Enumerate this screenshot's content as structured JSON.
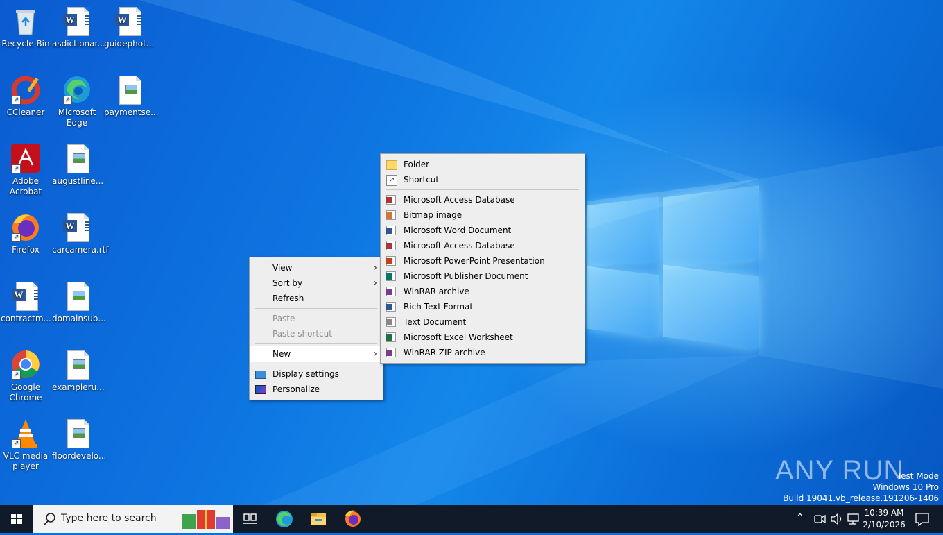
{
  "desktop_icons": [
    {
      "id": "recycle-bin",
      "label": "Recycle Bin",
      "icon": "recycle-bin-icon"
    },
    {
      "id": "asdictionar",
      "label": "asdictionar...",
      "icon": "word-document-icon"
    },
    {
      "id": "guidephot",
      "label": "guidephot...",
      "icon": "word-document-icon"
    },
    {
      "id": "ccleaner",
      "label": "CCleaner",
      "icon": "ccleaner-icon"
    },
    {
      "id": "edge",
      "label": "Microsoft Edge",
      "icon": "edge-icon"
    },
    {
      "id": "paymentse",
      "label": "paymentse...",
      "icon": "image-file-icon"
    },
    {
      "id": "acrobat",
      "label": "Adobe Acrobat",
      "icon": "adobe-acrobat-icon"
    },
    {
      "id": "augustline",
      "label": "augustline...",
      "icon": "image-file-icon"
    },
    {
      "id": "firefox",
      "label": "Firefox",
      "icon": "firefox-icon"
    },
    {
      "id": "carcamera",
      "label": "carcamera.rtf",
      "icon": "word-document-icon"
    },
    {
      "id": "contractm",
      "label": "contractm...",
      "icon": "word-document-icon"
    },
    {
      "id": "domainsub",
      "label": "domainsub...",
      "icon": "image-file-icon"
    },
    {
      "id": "chrome",
      "label": "Google Chrome",
      "icon": "chrome-icon"
    },
    {
      "id": "exampleru",
      "label": "exampleru...",
      "icon": "image-file-icon"
    },
    {
      "id": "vlc",
      "label": "VLC media player",
      "icon": "vlc-icon"
    },
    {
      "id": "floordevelo",
      "label": "floordevelo...",
      "icon": "image-file-icon"
    }
  ],
  "context_menu": {
    "view": "View",
    "sort_by": "Sort by",
    "refresh": "Refresh",
    "paste": "Paste",
    "paste_shortcut": "Paste shortcut",
    "new": "New",
    "display_settings": "Display settings",
    "personalize": "Personalize",
    "submenu_arrow": "›"
  },
  "new_submenu": {
    "folder": "Folder",
    "shortcut": "Shortcut",
    "items": [
      {
        "label": "Microsoft Access Database",
        "icon": "access-icon",
        "color": "#a4373a"
      },
      {
        "label": "Bitmap image",
        "icon": "bitmap-icon",
        "color": "#d0763a"
      },
      {
        "label": "Microsoft Word Document",
        "icon": "word-icon",
        "color": "#2b5797"
      },
      {
        "label": "Microsoft Access Database",
        "icon": "access-icon",
        "color": "#a4373a"
      },
      {
        "label": "Microsoft PowerPoint Presentation",
        "icon": "powerpoint-icon",
        "color": "#c43e1c"
      },
      {
        "label": "Microsoft Publisher Document",
        "icon": "publisher-icon",
        "color": "#077568"
      },
      {
        "label": "WinRAR archive",
        "icon": "winrar-icon",
        "color": "#7a3b8f"
      },
      {
        "label": "Rich Text Format",
        "icon": "rtf-icon",
        "color": "#2b5797"
      },
      {
        "label": "Text Document",
        "icon": "text-document-icon",
        "color": "#888888"
      },
      {
        "label": "Microsoft Excel Worksheet",
        "icon": "excel-icon",
        "color": "#1e7145"
      },
      {
        "label": "WinRAR ZIP archive",
        "icon": "winrar-zip-icon",
        "color": "#7a3b8f"
      }
    ]
  },
  "taskbar": {
    "search_placeholder": "Type here to search",
    "clock_time": "10:39 AM",
    "clock_date": "2/10/2026"
  },
  "watermark": {
    "brand": "ANY RUN",
    "line1": "Test Mode",
    "line2": "Windows 10 Pro",
    "line3": "Build 19041.vb_release.191206-1406"
  },
  "colors": {
    "desktop_blue": "#0a72d8",
    "taskbar": "#111a28",
    "menu_bg": "#eeeeee"
  }
}
